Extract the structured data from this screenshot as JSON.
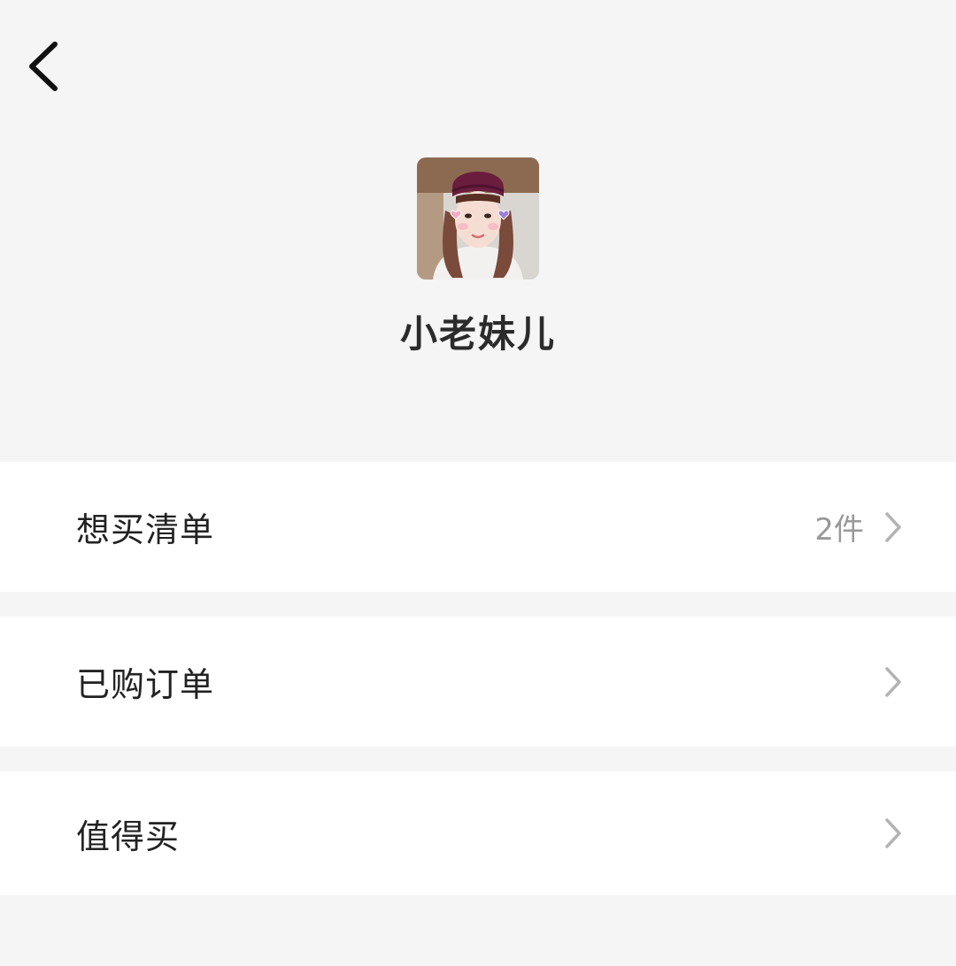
{
  "header": {
    "back_icon": "chevron-left-icon"
  },
  "profile": {
    "name": "小老妹儿"
  },
  "menu": {
    "items": [
      {
        "label": "想买清单",
        "count": "2件",
        "icon": "chevron-right-icon"
      },
      {
        "label": "已购订单",
        "count": "",
        "icon": "chevron-right-icon"
      },
      {
        "label": "值得买",
        "count": "",
        "icon": "chevron-right-icon"
      }
    ]
  },
  "colors": {
    "background": "#f5f5f5",
    "card": "#ffffff",
    "text_primary": "#222222",
    "text_secondary": "#999999",
    "chevron": "#b3b3b3"
  }
}
